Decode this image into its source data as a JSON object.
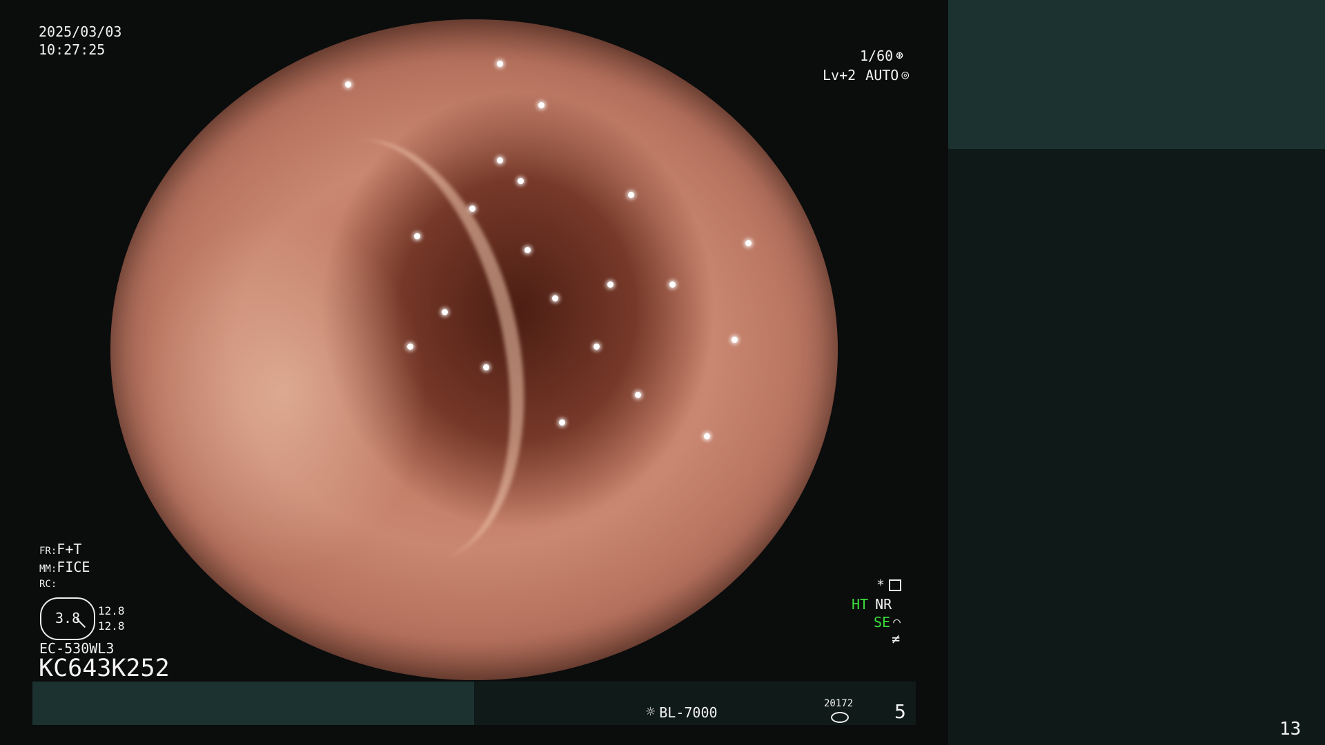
{
  "overlay": {
    "date": "2025/03/03",
    "time": "10:27:25",
    "shutter": "1/60",
    "level": "Lv+2",
    "mode": "AUTO",
    "fr_label": "FR:",
    "fr_value": "F+T",
    "mm_label": "MM:",
    "mm_value": "FICE",
    "rc_label": "RC:",
    "rc_value": "3.8",
    "rc_top": "12.8",
    "rc_bottom": "12.8",
    "scope_model": "EC-530WL3",
    "serial": "KC643K252",
    "star": "*",
    "ht": "HT",
    "nr": "NR",
    "se": "SE",
    "light_source": "BL-7000",
    "counter": "20172",
    "index": "5",
    "page_number": "13"
  },
  "colors": {
    "accent_panel": "#1b3230",
    "dark_panel": "#101a19",
    "indicator_green": "#3be03b"
  }
}
